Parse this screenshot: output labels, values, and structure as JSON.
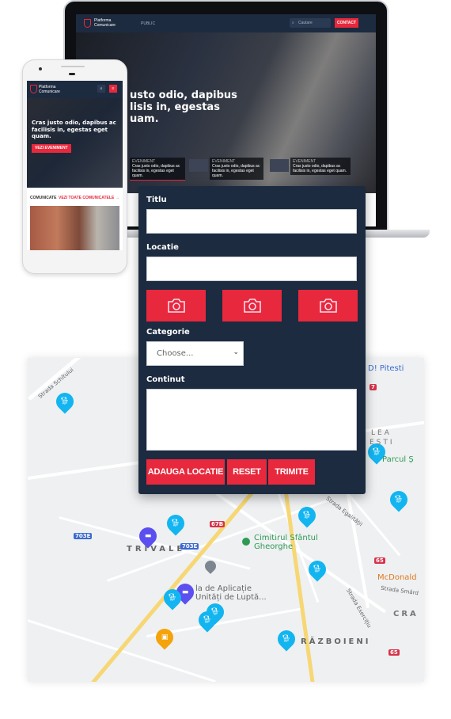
{
  "laptop": {
    "logo_line1": "Platforma",
    "logo_line2": "Comunicare",
    "nav_link": "PUBLIC",
    "search_placeholder": "Cautare",
    "contact_button": "CONTACT",
    "hero_title": "usto odio, dapibus\nlisis in, egestas\nuam.",
    "cards": [
      {
        "tag": "EVENIMENT",
        "text": "Cras justo odio, dapibus ac facilisis in, egestas eget quam."
      },
      {
        "tag": "EVENIMENT",
        "text": "Cras justo odio, dapibus ac facilisis in, egestas eget quam."
      },
      {
        "tag": "EVENIMENT",
        "text": "Cras justo odio, dapibus ac facilisis in, egestas eget quam."
      }
    ]
  },
  "phone": {
    "logo_line1": "Platforma",
    "logo_line2": "Comunicare",
    "hero_title": "Cras justo odio, dapibus ac facilisis in, egestas eget quam.",
    "hero_button": "VEZI EVENIMENT",
    "section_title": "COMUNICATE",
    "section_link": "VEZI TOATE COMUNICATELE"
  },
  "form": {
    "title_label": "Titlu",
    "title_value": "",
    "location_label": "Locatie",
    "location_value": "",
    "category_label": "Categorie",
    "category_selected": "Choose...",
    "content_label": "Continut",
    "content_value": "",
    "add_location_button": "ADAUGA LOCATIE",
    "reset_button": "RESET",
    "submit_button": "TRIMITE",
    "accent_color": "#e8283c",
    "panel_color": "#1c2b40"
  },
  "map": {
    "labels": {
      "street_schitului": "Strada Schitului",
      "pitesti": "D! Pitesti",
      "lea": "LEA",
      "esti": "EȘTI",
      "parcul": "Parcul Ș",
      "egalitatii": "Strada Egalității",
      "trivale": "TRIVALE",
      "cimitirul_1": "Cimitirul Sfântul",
      "cimitirul_2": "Gheorghe",
      "scoala_1": "la de Aplicație",
      "scoala_2": "Unități de Luptă...",
      "mcdonalds": "McDonald",
      "smardan": "Strada Smârd",
      "cra": "CRA",
      "exercitiu": "Strada Exercițiu",
      "razboieni": "RĂZBOIENI"
    },
    "route_shields": {
      "r703e_a": "703E",
      "r703e_b": "703E",
      "r67b": "67B",
      "r7": "7",
      "r65_a": "65",
      "r65_b": "65"
    },
    "pin_colors": {
      "dog": "#12b5f0",
      "car": "#5b4ff0",
      "other": "#f5a30a"
    }
  }
}
